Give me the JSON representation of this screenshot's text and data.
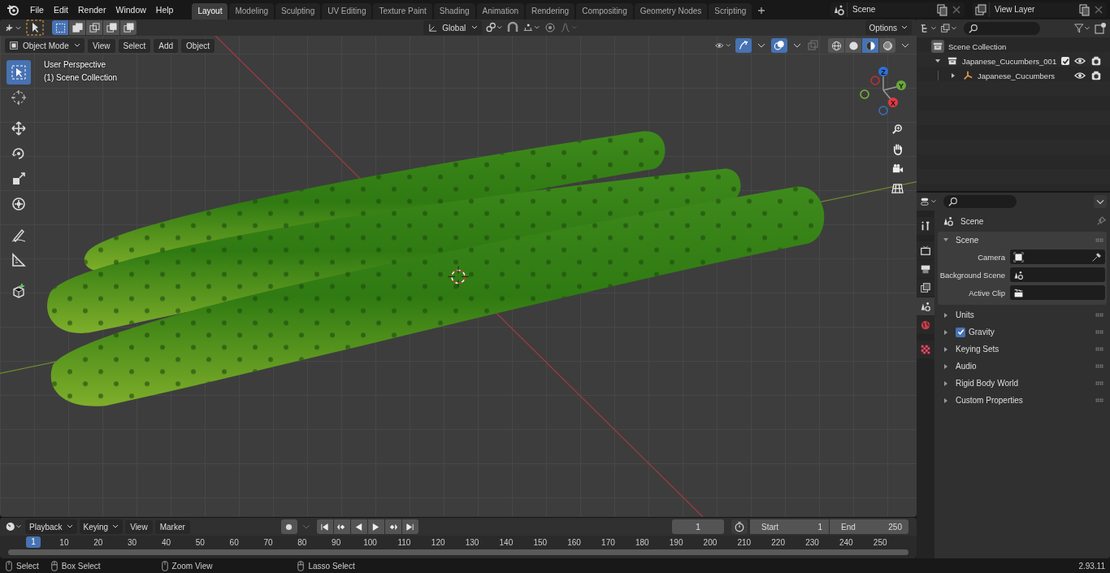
{
  "menu": [
    "File",
    "Edit",
    "Render",
    "Window",
    "Help"
  ],
  "workspaces": [
    {
      "label": "Layout",
      "selected": true
    },
    {
      "label": "Modeling",
      "selected": false
    },
    {
      "label": "Sculpting",
      "selected": false
    },
    {
      "label": "UV Editing",
      "selected": false
    },
    {
      "label": "Texture Paint",
      "selected": false
    },
    {
      "label": "Shading",
      "selected": false
    },
    {
      "label": "Animation",
      "selected": false
    },
    {
      "label": "Rendering",
      "selected": false
    },
    {
      "label": "Compositing",
      "selected": false
    },
    {
      "label": "Geometry Nodes",
      "selected": false
    },
    {
      "label": "Scripting",
      "selected": false
    }
  ],
  "scene_selector": {
    "value": "Scene"
  },
  "view_layer_selector": {
    "value": "View Layer"
  },
  "tool_header": {
    "select_modes": [
      {
        "selected": true
      },
      {
        "selected": false
      },
      {
        "selected": false
      },
      {
        "selected": false
      },
      {
        "selected": false
      }
    ],
    "orientation": "Global",
    "options": "Options"
  },
  "viewport_header": {
    "mode": "Object Mode",
    "menus": [
      "View",
      "Select",
      "Add",
      "Object"
    ],
    "gizmos_on": true,
    "overlays_on": true,
    "shading_modes": [
      {
        "kind": "wireframe",
        "selected": false
      },
      {
        "kind": "solid",
        "selected": false
      },
      {
        "kind": "material",
        "selected": true
      },
      {
        "kind": "rendered",
        "selected": false
      }
    ]
  },
  "viewport": {
    "info": [
      "User Perspective",
      "(1) Scene Collection"
    ],
    "tools": [
      {
        "kind": "select",
        "selected": true
      },
      {
        "kind": "cursor",
        "selected": false
      },
      {
        "kind": "move",
        "selected": false
      },
      {
        "kind": "rotate",
        "selected": false
      },
      {
        "kind": "scale",
        "selected": false
      },
      {
        "kind": "transform",
        "selected": false
      },
      {
        "kind": "annotate",
        "selected": false
      },
      {
        "kind": "measure",
        "selected": false
      },
      {
        "kind": "add_cube",
        "selected": false
      }
    ],
    "gizmo_axes": [
      "X",
      "Y",
      "Z"
    ]
  },
  "outliner": {
    "root": "Scene Collection",
    "items": [
      {
        "kind": "collection",
        "label": "Japanese_Cucumbers_001",
        "expanded": true,
        "checked": true,
        "children": [
          {
            "kind": "object",
            "label": "Japanese_Cucumbers",
            "expanded": false
          }
        ]
      }
    ]
  },
  "properties": {
    "tabs": [
      {
        "kind": "tool",
        "selected": false
      },
      {
        "kind": "render",
        "selected": false
      },
      {
        "kind": "output",
        "selected": false
      },
      {
        "kind": "view_layer",
        "selected": false
      },
      {
        "kind": "scene",
        "selected": true
      },
      {
        "kind": "world",
        "selected": false
      },
      {
        "kind": "texture",
        "selected": false
      }
    ],
    "title": "Scene",
    "panel": {
      "label": "Scene",
      "expanded": true,
      "fields": [
        {
          "label": "Camera",
          "kind": "camera"
        },
        {
          "label": "Background Scene",
          "kind": "scene"
        },
        {
          "label": "Active Clip",
          "kind": "clip"
        }
      ]
    },
    "sections": [
      {
        "label": "Units",
        "expanded": false
      },
      {
        "label": "Gravity",
        "expanded": false,
        "checked": true
      },
      {
        "label": "Keying Sets",
        "expanded": false
      },
      {
        "label": "Audio",
        "expanded": false
      },
      {
        "label": "Rigid Body World",
        "expanded": false
      },
      {
        "label": "Custom Properties",
        "expanded": false
      }
    ]
  },
  "timeline": {
    "menus": [
      {
        "label": "Playback",
        "kind": "dropdown"
      },
      {
        "label": "Keying",
        "kind": "dropdown"
      },
      {
        "label": "View",
        "kind": "plain"
      },
      {
        "label": "Marker",
        "kind": "plain"
      }
    ],
    "current_frame": "1",
    "start_label": "Start",
    "start": "1",
    "end_label": "End",
    "end": "250",
    "playhead": "1",
    "ticks": [
      "10",
      "20",
      "30",
      "40",
      "50",
      "60",
      "70",
      "80",
      "90",
      "100",
      "110",
      "120",
      "130",
      "140",
      "150",
      "160",
      "170",
      "180",
      "190",
      "200",
      "210",
      "220",
      "230",
      "240",
      "250"
    ]
  },
  "status_bar": {
    "hints": [
      "Select",
      "Box Select",
      "Zoom View",
      "Lasso Select"
    ],
    "version": "2.93.11"
  }
}
